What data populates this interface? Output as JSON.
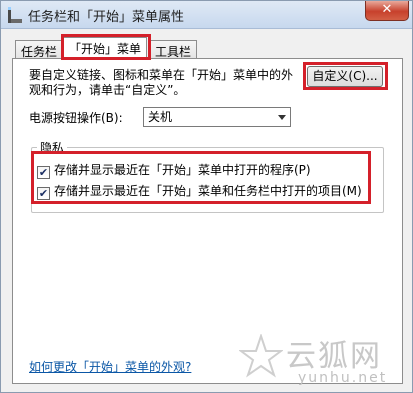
{
  "window": {
    "title": "任务栏和「开始」菜单属性",
    "close_glyph": "✕"
  },
  "tabs": [
    {
      "label": "任务栏",
      "active": false
    },
    {
      "label": "「开始」菜单",
      "active": true
    },
    {
      "label": "工具栏",
      "active": false
    }
  ],
  "start_menu": {
    "description": "要自定义链接、图标和菜单在「开始」菜单中的外观和行为，请单击“自定义”。",
    "customize_button": "自定义(C)...",
    "power_label": "电源按钮操作(B):",
    "power_value": "关机",
    "privacy": {
      "label": "隐私",
      "options": [
        {
          "label": "存储并显示最近在「开始」菜单中打开的程序(P)",
          "checked": true
        },
        {
          "label": "存储并显示最近在「开始」菜单和任务栏中打开的项目(M)",
          "checked": true
        }
      ]
    },
    "help_link": "如何更改「开始」菜单的外观?"
  },
  "watermark": {
    "text": "云狐网",
    "url": "yunhu.net"
  },
  "colors": {
    "highlight": "#d4202a",
    "link": "#0b57a6"
  }
}
